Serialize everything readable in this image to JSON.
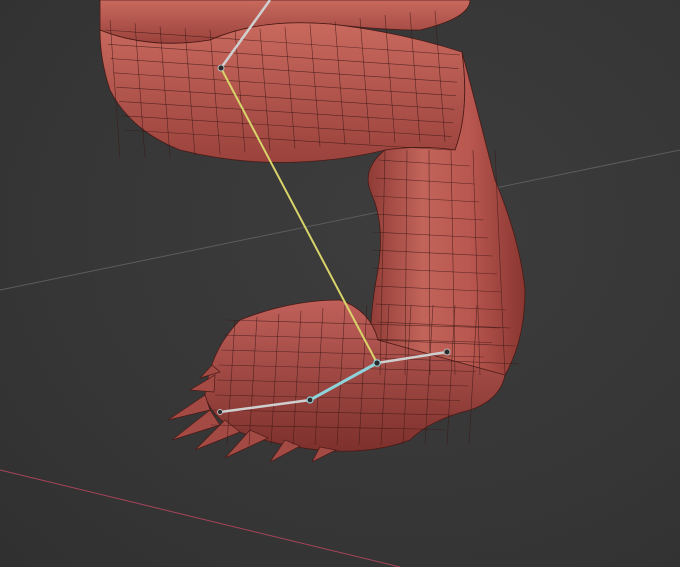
{
  "app": "3D viewport",
  "viewport": {
    "background": "#393939",
    "grid_color": "#5a5a5a",
    "x_axis_color": "#b0455a"
  },
  "mesh": {
    "name_hint": "creature-leg-mesh",
    "fill": "#b8574f",
    "shade": "#8f3b36",
    "highlight": "#d07468",
    "wire": "#3b1714"
  },
  "bones": {
    "ik_chain_color": "#d9d46a",
    "selected_color": "#8fd3da",
    "bone_color": "#cfcfcf",
    "joint_color": "#2a2a2a"
  }
}
